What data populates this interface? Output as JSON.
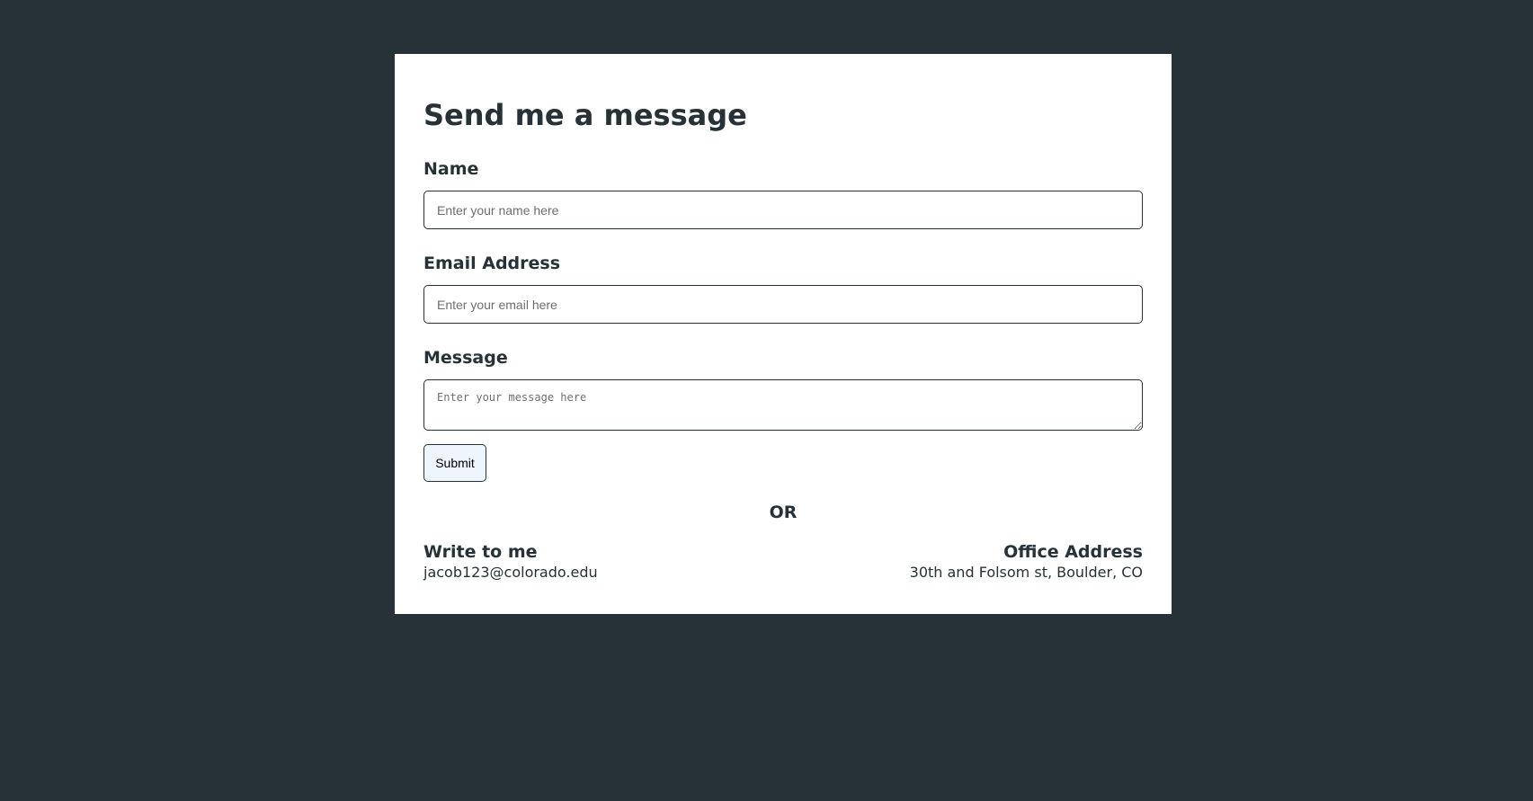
{
  "form": {
    "title": "Send me a message",
    "name_label": "Name",
    "name_placeholder": "Enter your name here",
    "email_label": "Email Address",
    "email_placeholder": "Enter your email here",
    "message_label": "Message",
    "message_placeholder": "Enter your message here",
    "submit_label": "Submit"
  },
  "divider": {
    "text": "OR"
  },
  "contact": {
    "write_heading": "Write to me",
    "email": "jacob123@colorado.edu",
    "office_heading": "Office Address",
    "address": "30th and Folsom st, Boulder, CO"
  },
  "colors": {
    "background": "#263238",
    "card": "#ffffff",
    "text": "#263238",
    "button": "#eef5fc"
  }
}
